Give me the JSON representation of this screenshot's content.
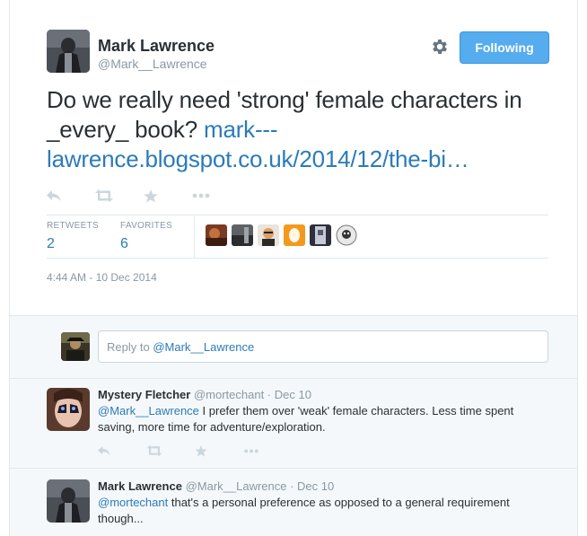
{
  "tweet": {
    "author_name": "Mark Lawrence",
    "author_handle": "@Mark__Lawrence",
    "follow_label": "Following",
    "text_plain": "Do we really need 'strong' female characters in _every_ book?",
    "link_part1": "mark---",
    "link_part2": "lawrence.blogspot.co.uk/2014/12/the-bi…",
    "stats": {
      "retweets_label": "RETWEETS",
      "retweets_value": "2",
      "favorites_label": "FAVORITES",
      "favorites_value": "6"
    },
    "timestamp": "4:44 AM - 10 Dec 2014"
  },
  "reply_box": {
    "prefix": "Reply to",
    "mention": "@Mark__Lawrence"
  },
  "replies": [
    {
      "name": "Mystery Fletcher",
      "handle": "@mortechant",
      "date": "Dec 10",
      "mention": "@Mark__Lawrence",
      "text": "I prefer them over 'weak' female characters. Less time spent saving, more time for adventure/exploration."
    },
    {
      "name": "Mark Lawrence",
      "handle": "@Mark__Lawrence",
      "date": "Dec 10",
      "mention": "@mortechant",
      "text": "that's a personal preference as opposed to a general requirement though..."
    }
  ],
  "colors": {
    "accent": "#55acee",
    "link": "#2b7bb9",
    "muted": "#8899a6",
    "icon": "#ccd6dd",
    "border": "#e1e8ed",
    "reply_bg": "#f5f8fa"
  },
  "icons": [
    "gear-icon",
    "reply-icon",
    "retweet-icon",
    "favorite-star-icon",
    "more-dots-icon"
  ],
  "separator": " · "
}
